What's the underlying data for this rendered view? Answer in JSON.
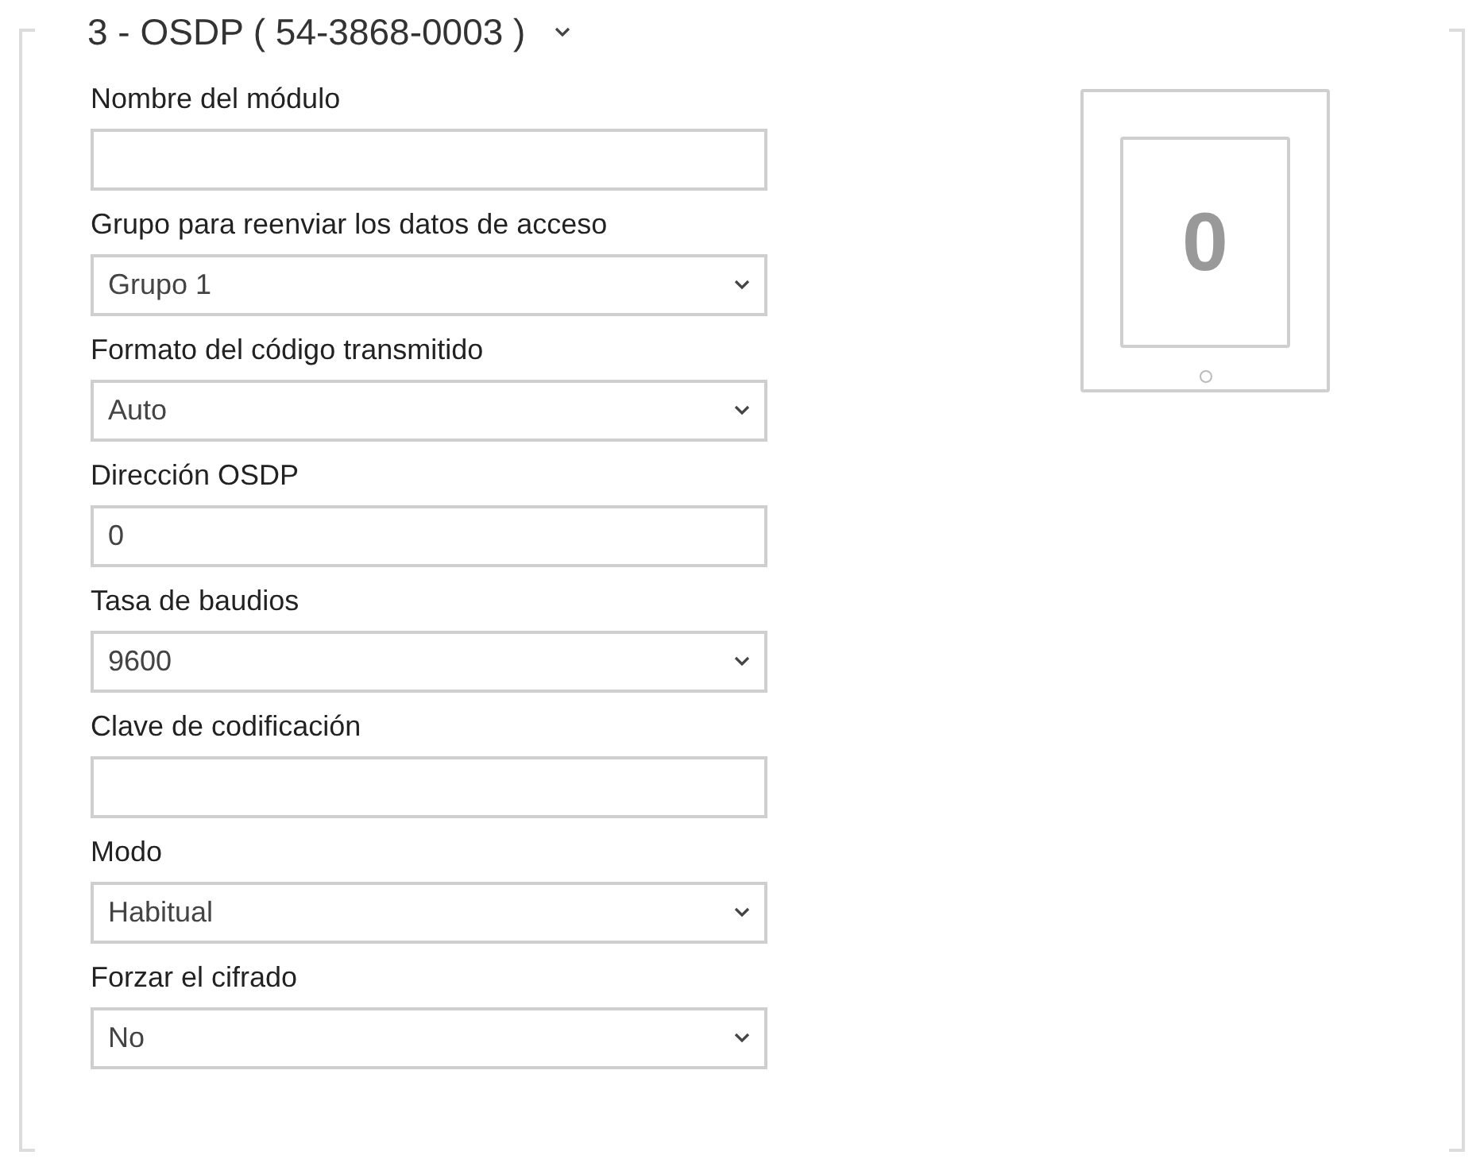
{
  "section": {
    "title": "3 - OSDP ( 54-3868-0003 )",
    "expanded": true
  },
  "fields": [
    {
      "label": "Nombre del módulo",
      "kind": "text"
    },
    {
      "label": "Grupo para reenviar los datos de acceso",
      "kind": "select",
      "value": "Grupo 1"
    },
    {
      "label": "Formato del código transmitido",
      "kind": "select",
      "value": "Auto"
    },
    {
      "label": "Dirección OSDP",
      "kind": "text",
      "value": "0"
    },
    {
      "label": "Tasa de baudios",
      "kind": "select",
      "value": "9600"
    },
    {
      "label": "Clave de codificación",
      "kind": "text"
    },
    {
      "label": "Modo",
      "kind": "select",
      "value": "Habitual"
    },
    {
      "label": "Forzar el cifrado",
      "kind": "select",
      "value": "No"
    }
  ],
  "device": {
    "display": "0"
  }
}
